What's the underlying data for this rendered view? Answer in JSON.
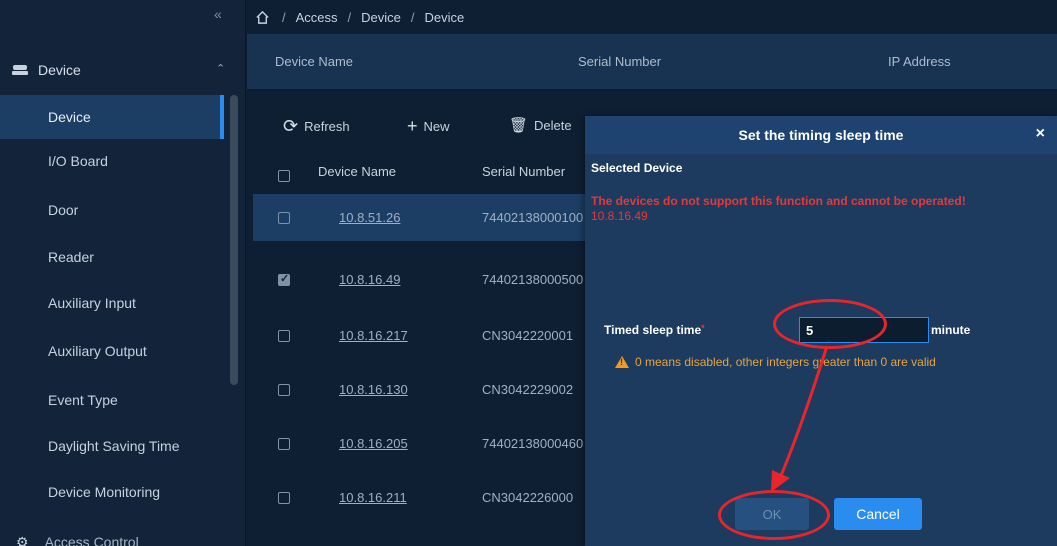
{
  "sidebar": {
    "collapse_icon": "double-chevron-left-icon",
    "group_device": "Device",
    "items": [
      {
        "label": "Device",
        "active": true
      },
      {
        "label": "I/O Board"
      },
      {
        "label": "Door"
      },
      {
        "label": "Reader"
      },
      {
        "label": "Auxiliary Input"
      },
      {
        "label": "Auxiliary Output"
      },
      {
        "label": "Event Type"
      },
      {
        "label": "Daylight Saving Time"
      },
      {
        "label": "Device Monitoring"
      }
    ],
    "group_access": "Access Control"
  },
  "breadcrumb": {
    "home_icon": "home-icon",
    "items": [
      "Access",
      "Device",
      "Device"
    ],
    "separator": "/"
  },
  "background_header": {
    "columns": [
      "Device Name",
      "Serial Number",
      "IP Address"
    ]
  },
  "toolbar": {
    "refresh": "Refresh",
    "new": "New",
    "delete": "Delete"
  },
  "table": {
    "columns": [
      "Device Name",
      "Serial Number"
    ],
    "rows": [
      {
        "name": "10.8.51.26",
        "serial": "74402138000100",
        "checked": false,
        "selected": true
      },
      {
        "name": "10.8.16.49",
        "serial": "74402138000500",
        "checked": true,
        "selected": false
      },
      {
        "name": "10.8.16.217",
        "serial": "CN3042220001",
        "checked": false,
        "selected": false
      },
      {
        "name": "10.8.16.130",
        "serial": "CN3042229002",
        "checked": false,
        "selected": false
      },
      {
        "name": "10.8.16.205",
        "serial": "74402138000460",
        "checked": false,
        "selected": false
      },
      {
        "name": "10.8.16.211",
        "serial": "CN3042226000",
        "checked": false,
        "selected": false
      }
    ]
  },
  "dialog": {
    "title": "Set the timing sleep time",
    "close": "×",
    "selected_device_label": "Selected Device",
    "warning": "The devices do not support this function and cannot be operated!",
    "warning_ip": "10.8.16.49",
    "sleep_label": "Timed sleep time",
    "required_mark": "*",
    "sleep_value": "5",
    "unit": "minute",
    "hint": "0 means disabled, other integers greater than 0 are valid",
    "ok": "OK",
    "cancel": "Cancel"
  },
  "colors": {
    "accent": "#2b8cf0",
    "warning_red": "#e4393c",
    "annotation_red": "#e8252b"
  }
}
